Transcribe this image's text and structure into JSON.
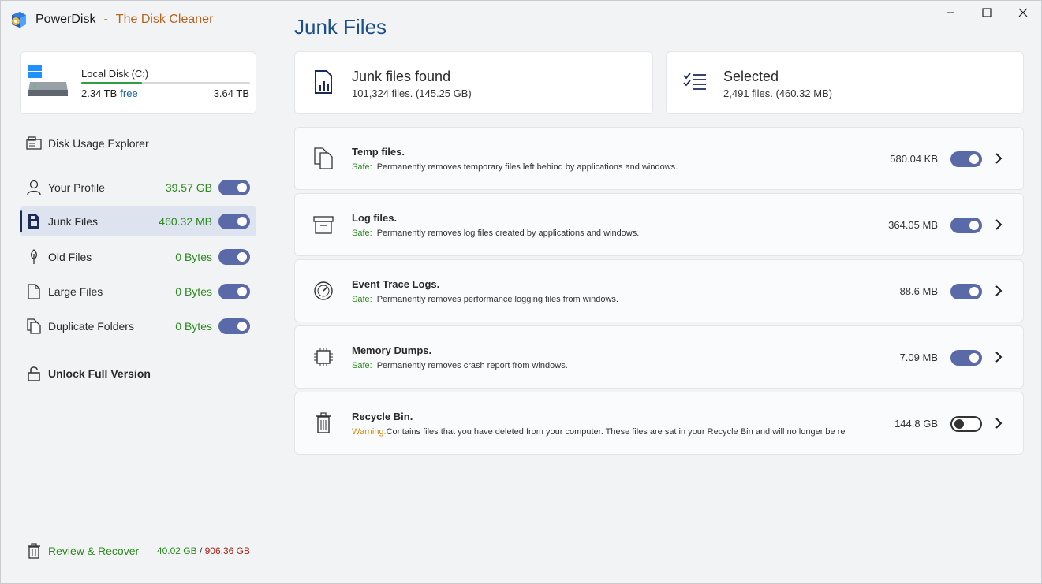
{
  "app": {
    "name": "PowerDisk",
    "separator": "-",
    "tagline": "The Disk Cleaner"
  },
  "window_controls": [
    "minimize",
    "maximize",
    "close"
  ],
  "disk": {
    "label": "Local Disk (C:)",
    "free": "2.34 TB",
    "free_word": "free",
    "total": "3.64 TB",
    "used_fraction": 0.36
  },
  "sidebar": {
    "items": [
      {
        "label": "Disk Usage Explorer",
        "icon": "disk-usage-icon"
      },
      {
        "label": "Your Profile",
        "size": "39.57 GB",
        "toggle": true,
        "icon": "person-icon"
      },
      {
        "label": "Junk Files",
        "size": "460.32 MB",
        "toggle": true,
        "icon": "junk-file-icon",
        "active": true
      },
      {
        "label": "Old Files",
        "size": "0 Bytes",
        "toggle": true,
        "icon": "old-files-icon"
      },
      {
        "label": "Large Files",
        "size": "0 Bytes",
        "toggle": true,
        "icon": "file-icon"
      },
      {
        "label": "Duplicate Folders",
        "size": "0 Bytes",
        "toggle": true,
        "icon": "duplicate-icon"
      },
      {
        "label": "Unlock Full Version",
        "icon": "lock-icon"
      }
    ],
    "review": {
      "label": "Review & Recover",
      "recovered": "40.02 GB",
      "slash": "/",
      "total": "906.36 GB",
      "icon": "trash-icon"
    }
  },
  "main": {
    "title": "Junk Files",
    "found": {
      "title": "Junk files found",
      "sub": "101,324 files. (145.25 GB)"
    },
    "selected": {
      "title": "Selected",
      "sub": "2,491 files. (460.32 MB)"
    },
    "rows": [
      {
        "title": "Temp files.",
        "status": "Safe:",
        "desc": "Permanently removes temporary files left behind by applications and windows.",
        "size": "580.04 KB",
        "enabled": true,
        "icon": "temp-files-icon"
      },
      {
        "title": "Log files.",
        "status": "Safe:",
        "desc": "Permanently removes log files created by applications and windows.",
        "size": "364.05 MB",
        "enabled": true,
        "icon": "log-files-icon"
      },
      {
        "title": "Event Trace Logs.",
        "status": "Safe:",
        "desc": "Permanently removes performance logging files from windows.",
        "size": "88.6 MB",
        "enabled": true,
        "icon": "gauge-icon"
      },
      {
        "title": "Memory Dumps.",
        "status": "Safe:",
        "desc": "Permanently removes crash report from windows.",
        "size": "7.09 MB",
        "enabled": true,
        "icon": "chip-icon"
      },
      {
        "title": "Recycle Bin.",
        "status": "Warning:",
        "desc": "Contains files that you have deleted from your computer. These files are sat in your Recycle Bin and will no longer be re",
        "size": "144.8 GB",
        "enabled": false,
        "icon": "recycle-bin-icon"
      }
    ]
  },
  "colors": {
    "accent": "#1a4f8a",
    "brand_tag": "#b5651d",
    "safe": "#2b8a1d",
    "warning": "#d98a00",
    "toggle_on": "#5a6aa8",
    "deleted_total": "#a3261b"
  }
}
